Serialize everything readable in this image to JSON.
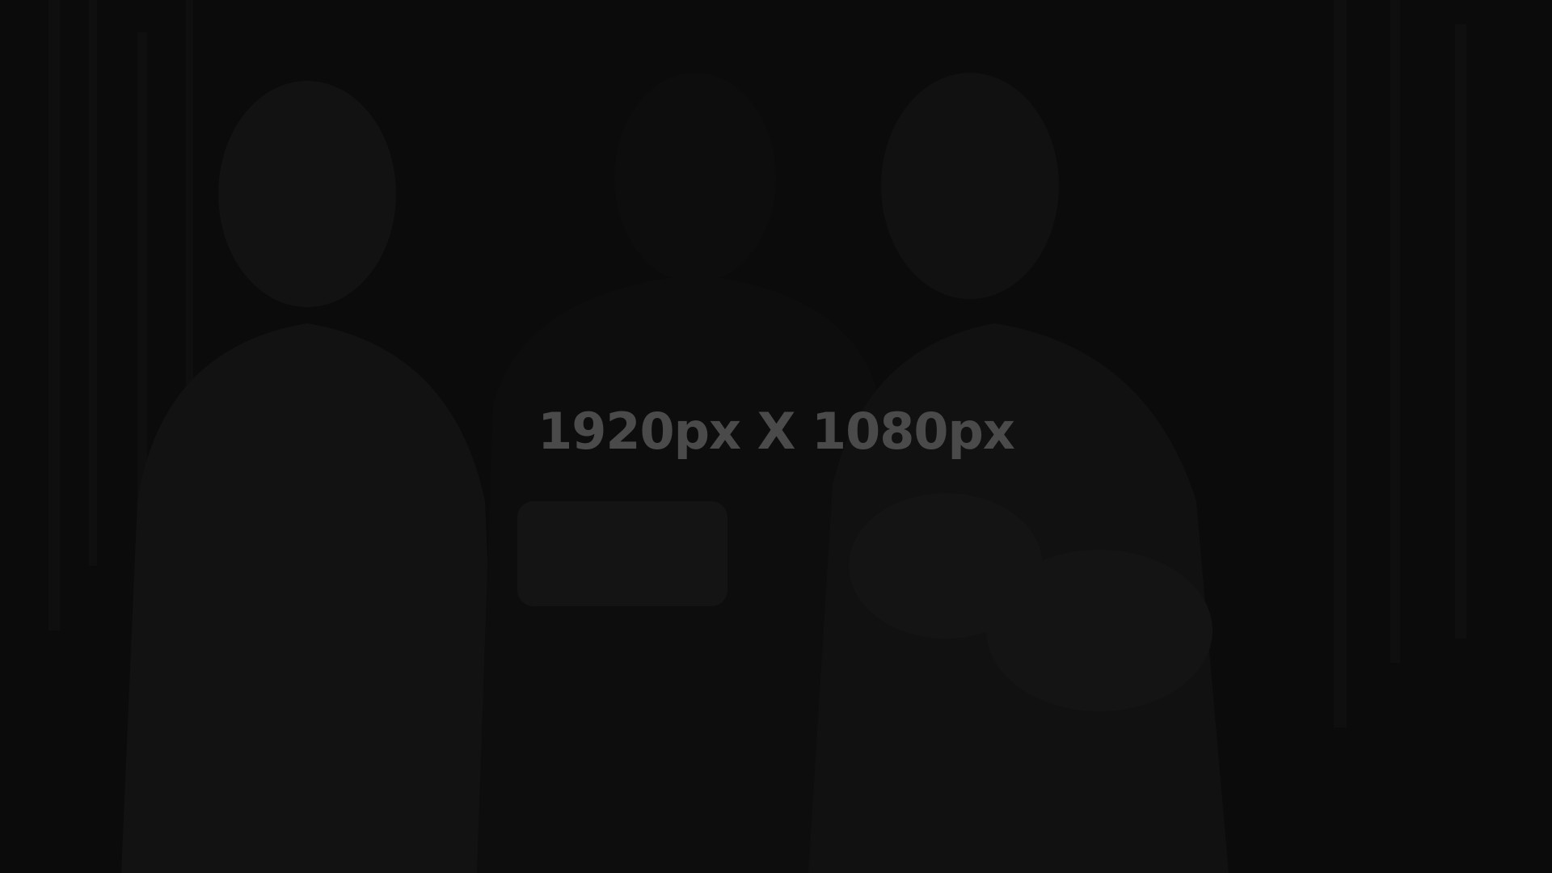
{
  "placeholder": {
    "dimension_text": "1920px X 1080px"
  },
  "colors": {
    "background": "#0b0b0b",
    "text": "#4a4a4a"
  }
}
